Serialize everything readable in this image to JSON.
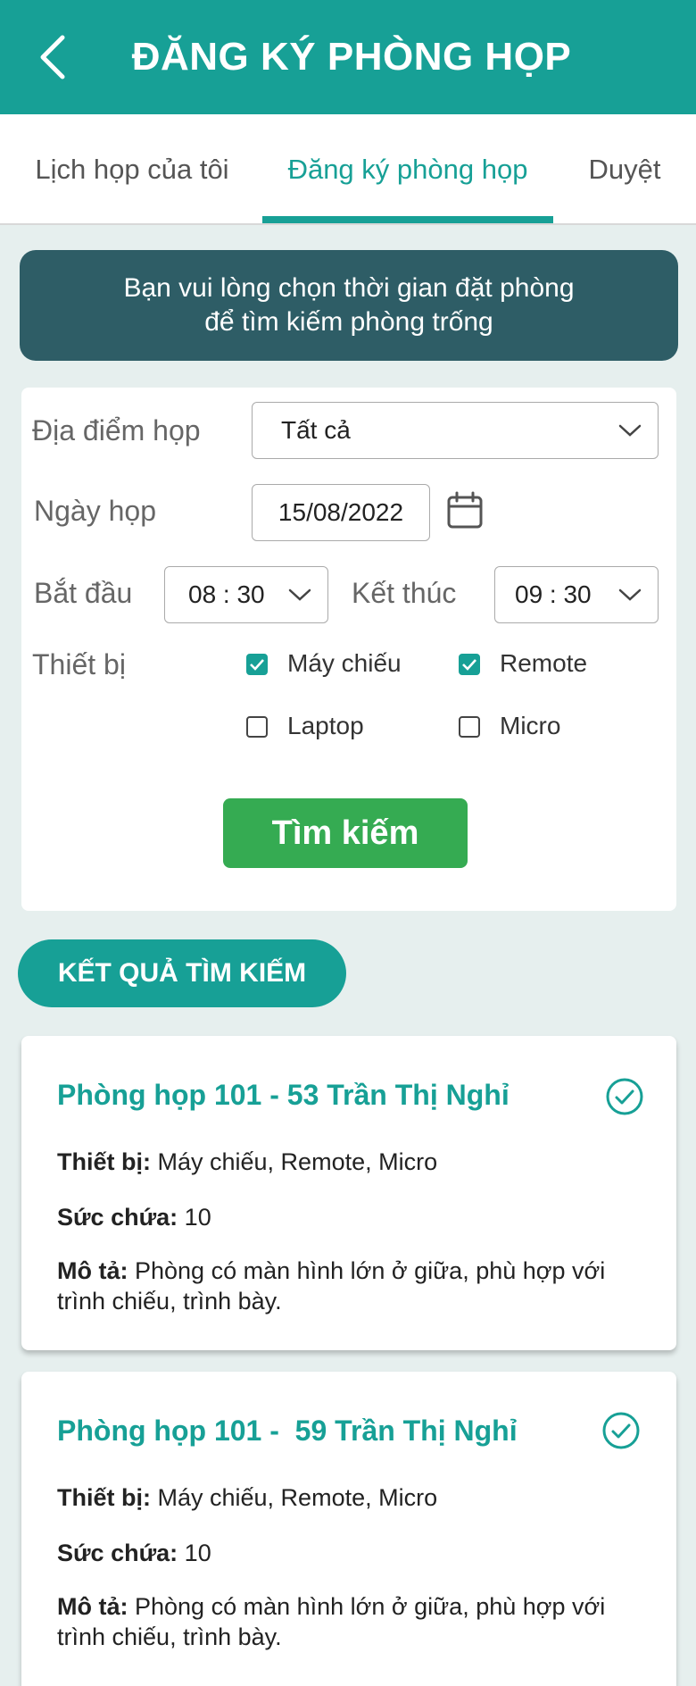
{
  "header": {
    "title": "ĐĂNG KÝ PHÒNG HỌP",
    "back_icon": "chevron-left-icon"
  },
  "tabs": [
    {
      "label": "Lịch họp của tôi",
      "active": false
    },
    {
      "label": "Đăng ký phòng họp",
      "active": true
    },
    {
      "label": "Duyệt",
      "active": false
    }
  ],
  "notice": {
    "line1": "Bạn vui lòng chọn thời gian đặt phòng",
    "line2": "để tìm kiếm phòng trống"
  },
  "form": {
    "location_label": "Địa điểm họp",
    "location_value": "Tất cả",
    "date_label": "Ngày họp",
    "date_value": "15/08/2022",
    "start_label": "Bắt đầu",
    "start_value": "08 : 30",
    "end_label": "Kết thúc",
    "end_value": "09 : 30",
    "equipment_label": "Thiết bị",
    "equipment": [
      {
        "label": "Máy chiếu",
        "checked": true
      },
      {
        "label": "Remote",
        "checked": true
      },
      {
        "label": "Laptop",
        "checked": false
      },
      {
        "label": "Micro",
        "checked": false
      }
    ],
    "search_button": "Tìm kiếm"
  },
  "results": {
    "heading": "KẾT QUẢ TÌM KIẾM",
    "rooms": [
      {
        "name": "Phòng họp 101 - 53 Trần Thị Nghỉ",
        "equipment_label": "Thiết bị:",
        "equipment": "Máy chiếu, Remote, Micro",
        "capacity_label": "Sức chứa:",
        "capacity": "10",
        "description_label": "Mô tả:",
        "description": "Phòng có màn hình lớn ở giữa, phù hợp với trình chiếu, trình bày."
      },
      {
        "name": "Phòng họp 101 -  59 Trần Thị Nghỉ",
        "equipment_label": "Thiết bị:",
        "equipment": "Máy chiếu, Remote, Micro",
        "capacity_label": "Sức chứa:",
        "capacity": "10",
        "description_label": "Mô tả:",
        "description": "Phòng có màn hình lớn ở giữa, phù hợp với trình chiếu, trình bày."
      }
    ]
  },
  "colors": {
    "primary": "#17a096",
    "notice_bg": "#2e5d66",
    "search_button": "#35ab52",
    "page_bg": "#e6efee"
  }
}
